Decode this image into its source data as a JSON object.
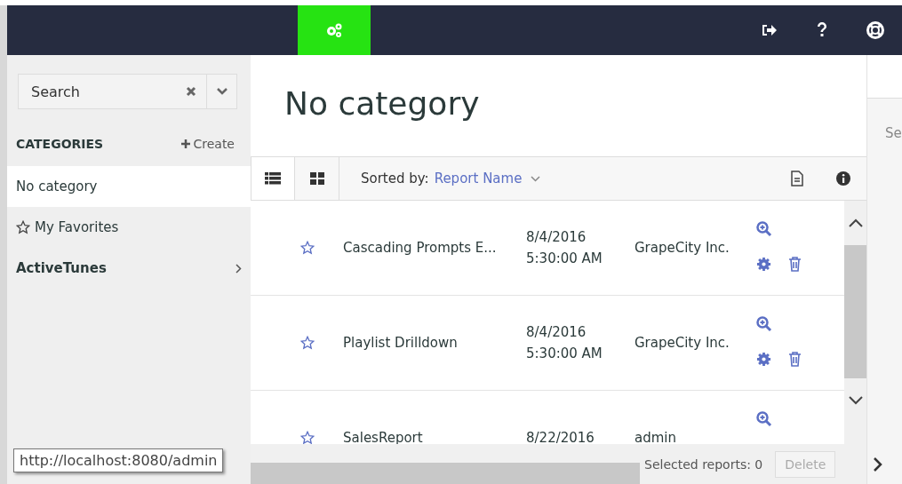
{
  "sidebar": {
    "search": {
      "placeholder": "Search"
    },
    "categories_label": "CATEGORIES",
    "create_label": "Create",
    "items": [
      {
        "label": "No category",
        "kind": "plain",
        "selected": true
      },
      {
        "label": "My Favorites",
        "kind": "favorites",
        "selected": false
      },
      {
        "label": "ActiveTunes",
        "kind": "group",
        "selected": false
      }
    ]
  },
  "main": {
    "title": "No category",
    "view_buttons": [
      {
        "kind": "list",
        "selected": true
      },
      {
        "kind": "grid",
        "selected": false
      }
    ],
    "sort_label": "Sorted by:",
    "sort_value": "Report Name",
    "reports": [
      {
        "name": "Cascading Prompts E...",
        "date": "8/4/2016",
        "time": "5:30:00 AM",
        "author": "GrapeCity Inc.",
        "favorite": false
      },
      {
        "name": "Playlist Drilldown",
        "date": "8/4/2016",
        "time": "5:30:00 AM",
        "author": "GrapeCity Inc.",
        "favorite": false
      },
      {
        "name": "SalesReport",
        "date": "8/22/2016",
        "author": "admin",
        "favorite": false
      }
    ],
    "footer": {
      "selected_label": "Selected reports: 0",
      "delete_label": "Delete",
      "delete_disabled": true
    }
  },
  "right_panel": {
    "label": "Se"
  },
  "tooltip": "http://localhost:8080/admin"
}
